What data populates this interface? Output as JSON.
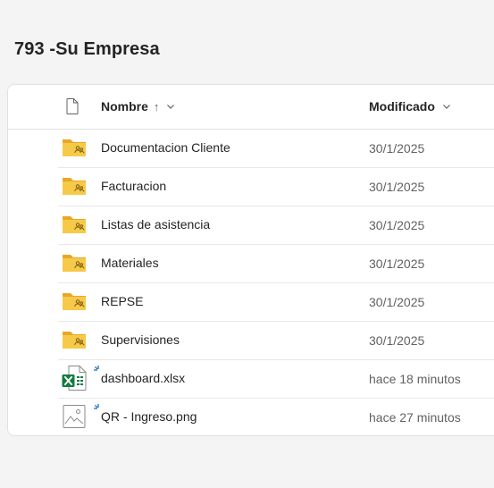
{
  "page": {
    "title": "793 -Su Empresa"
  },
  "columns": {
    "name_label": "Nombre",
    "name_sort_indicator": "↑",
    "modified_label": "Modificado"
  },
  "items": [
    {
      "name": "Documentacion Cliente",
      "modified": "30/1/2025",
      "type": "shared-folder",
      "icon": "shared-folder-icon"
    },
    {
      "name": "Facturacion",
      "modified": "30/1/2025",
      "type": "shared-folder",
      "icon": "shared-folder-icon"
    },
    {
      "name": "Listas de asistencia",
      "modified": "30/1/2025",
      "type": "shared-folder",
      "icon": "shared-folder-icon"
    },
    {
      "name": "Materiales",
      "modified": "30/1/2025",
      "type": "shared-folder",
      "icon": "shared-folder-icon"
    },
    {
      "name": "REPSE",
      "modified": "30/1/2025",
      "type": "shared-folder",
      "icon": "shared-folder-icon"
    },
    {
      "name": "Supervisiones",
      "modified": "30/1/2025",
      "type": "shared-folder",
      "icon": "shared-folder-icon"
    },
    {
      "name": "dashboard.xlsx",
      "modified": "hace 18 minutos",
      "type": "excel",
      "icon": "excel-file-icon",
      "new": true
    },
    {
      "name": "QR - Ingreso.png",
      "modified": "hace 27 minutos",
      "type": "image",
      "icon": "image-file-icon",
      "new": true
    }
  ],
  "colors": {
    "folder": "#f7c948",
    "folder_dark": "#e8a825",
    "excel_green": "#107c41",
    "new_badge": "#0f6cbd",
    "background": "#f4f4f4"
  }
}
